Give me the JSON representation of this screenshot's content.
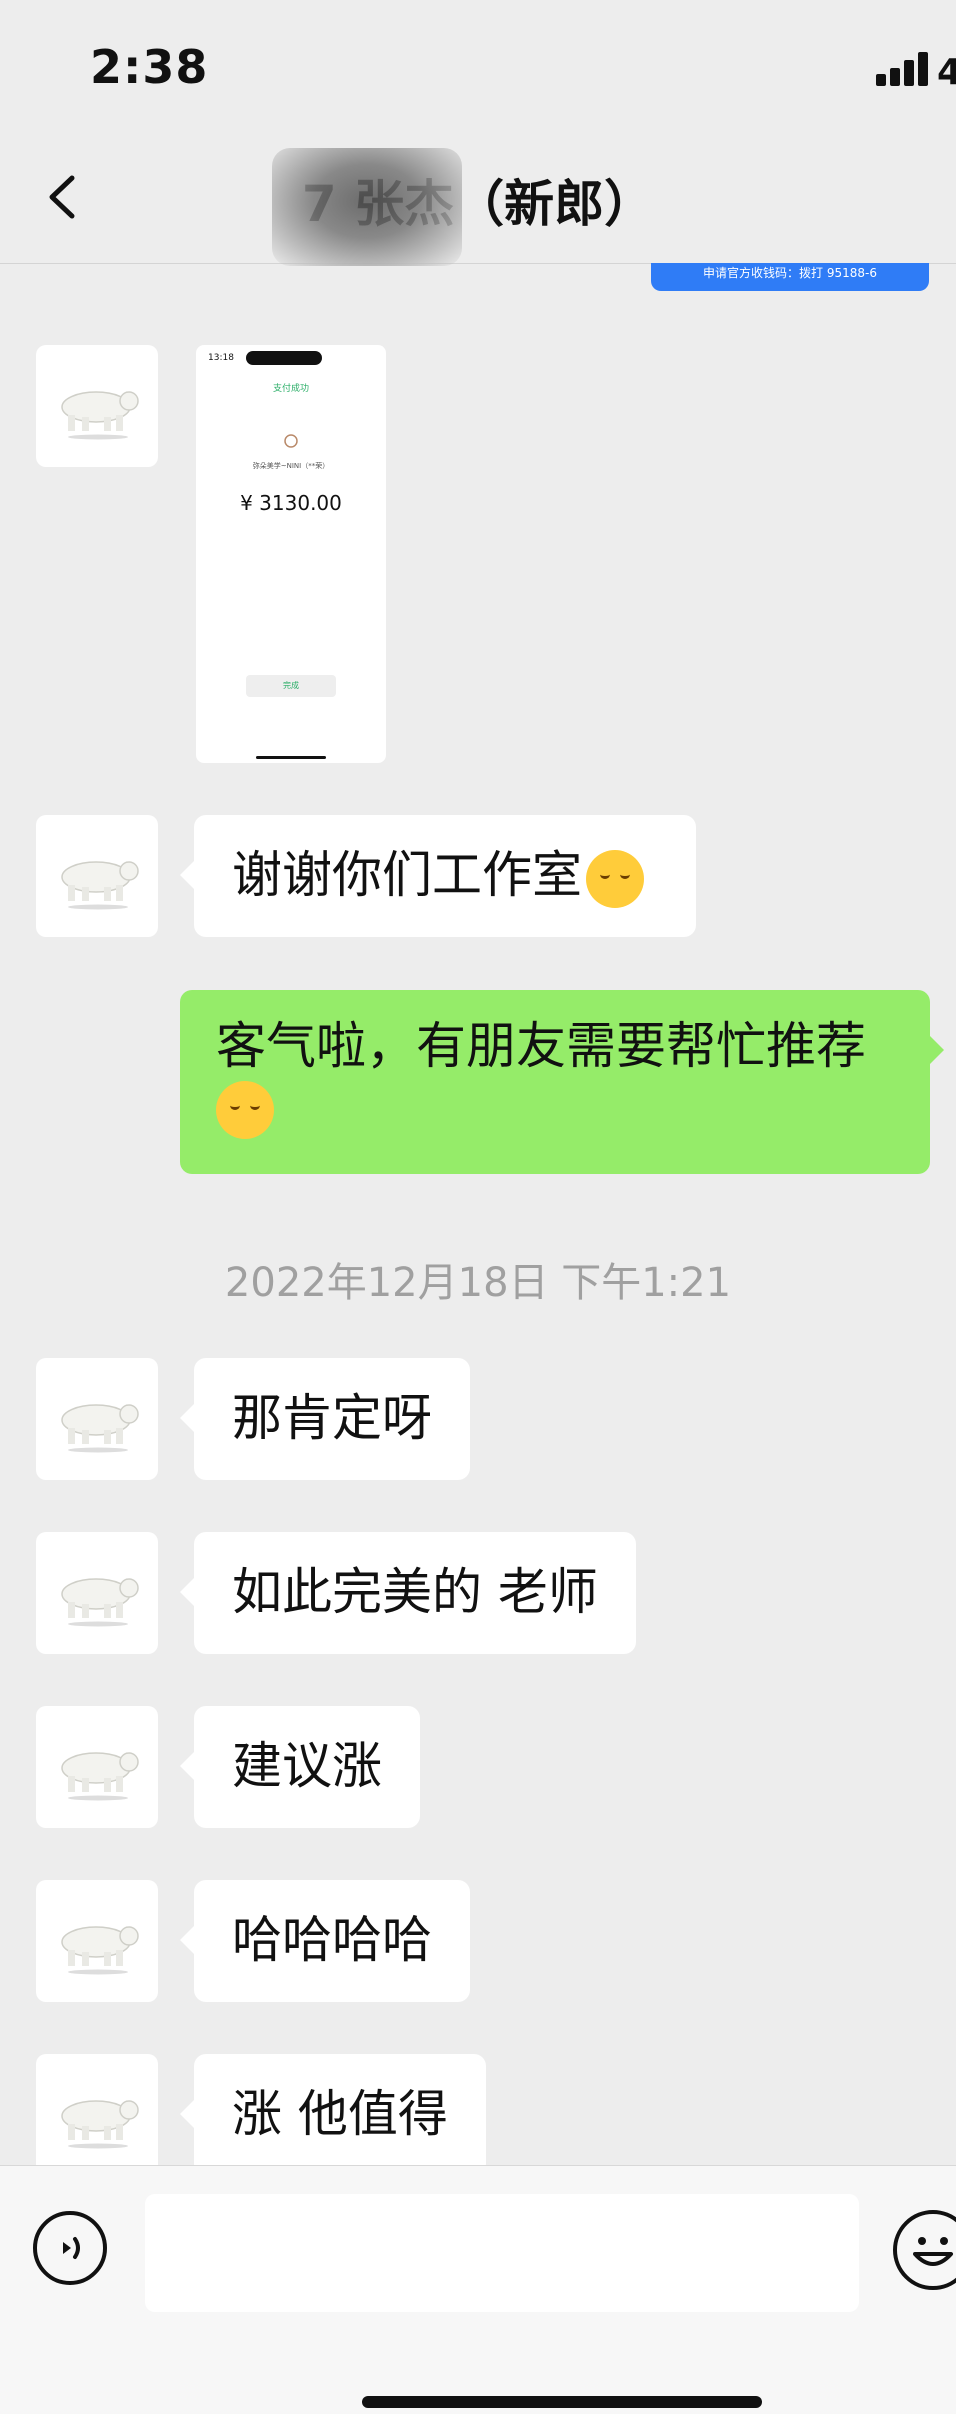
{
  "status_bar": {
    "time": "2:38",
    "battery_partial": "4"
  },
  "header": {
    "title": "7 张杰（新郎）"
  },
  "top_bubble": {
    "text": "申请官方收钱码：拨打 95188-6"
  },
  "payment_screenshot": {
    "time": "13:18",
    "success_text": "支付成功",
    "merchant": "弥朵美学~NINI（**荣）",
    "amount": "¥ 3130.00",
    "done_label": "完成"
  },
  "messages": [
    {
      "side": "left",
      "text": "谢谢你们工作室",
      "emoji": "saluting-face"
    },
    {
      "side": "right",
      "text": "客气啦，有朋友需要帮忙推荐",
      "emoji": "relieved-face"
    },
    {
      "side": "left",
      "text": "那肯定呀"
    },
    {
      "side": "left",
      "text": "如此完美的  老师"
    },
    {
      "side": "left",
      "text": "建议涨"
    },
    {
      "side": "left",
      "text": "哈哈哈哈"
    },
    {
      "side": "left",
      "text": "涨 他值得"
    }
  ],
  "timestamp": "2022年12月18日 下午1:21",
  "input": {
    "placeholder": ""
  },
  "colors": {
    "my_bubble": "#95ec69",
    "their_bubble": "#ffffff",
    "background": "#ededed",
    "blue_bubble": "#2f7cf6"
  }
}
